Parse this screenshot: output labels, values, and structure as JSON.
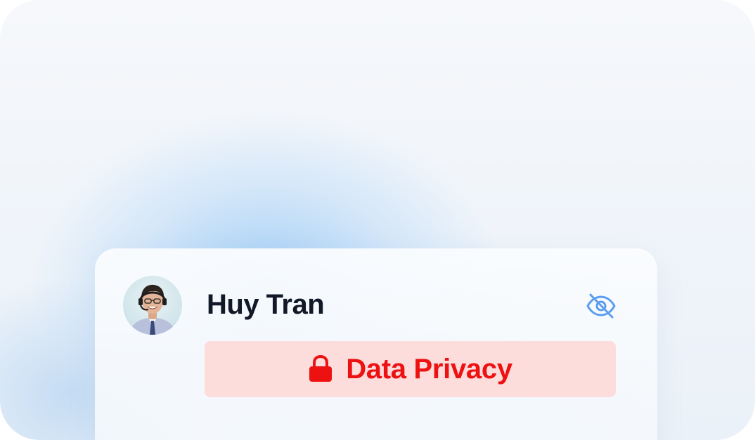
{
  "profile": {
    "name": "Huy Tran",
    "avatar_icon": "person-with-headset-avatar"
  },
  "visibility_toggle": {
    "icon": "eye-off-icon",
    "color": "#5b9df0"
  },
  "privacy_badge": {
    "label": "Data Privacy",
    "icon": "lock-icon",
    "text_color": "#ee1111",
    "background": "#fddcdc"
  }
}
